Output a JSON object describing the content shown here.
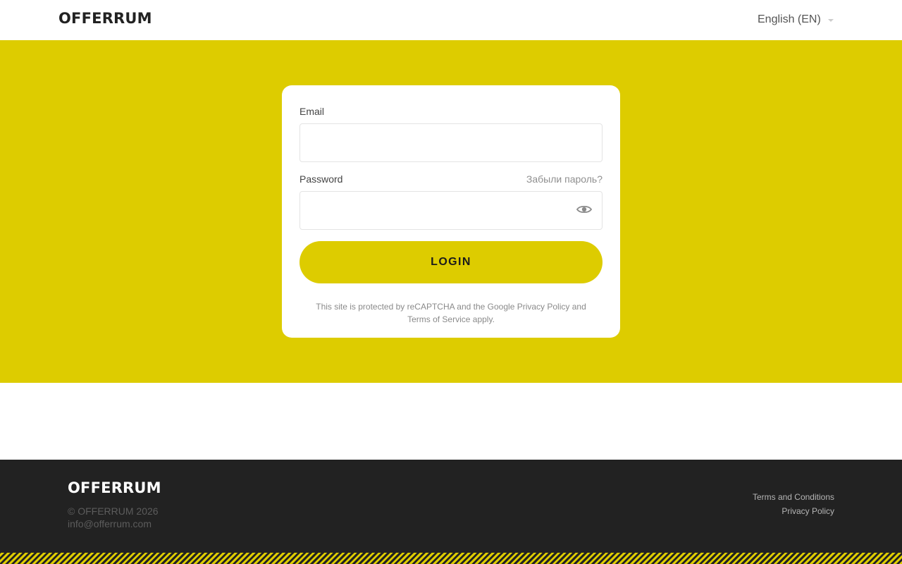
{
  "header": {
    "brand": "OFFERRUM",
    "language": "English (EN)"
  },
  "login": {
    "email_label": "Email",
    "email_value": "",
    "password_label": "Password",
    "password_value": "",
    "forgot_password": "Забыли пароль?",
    "submit_label": "LOGIN",
    "recaptcha_prefix": "This site is protected by reCAPTCHA and the Google ",
    "privacy_link": "Privacy Policy",
    "recaptcha_and": " and ",
    "terms_link": "Terms of Service",
    "recaptcha_suffix": " apply."
  },
  "footer": {
    "brand": "OFFERRUM",
    "copyright": "© OFFERRUM 2026",
    "email": "info@offerrum.com",
    "terms_link": "Terms and Conditions",
    "privacy_link": "Privacy Policy"
  },
  "icons": {
    "password_toggle": "eye-icon",
    "language_dropdown": "chevron-down-icon"
  },
  "colors": {
    "accent": "#ddcc00",
    "footer_bg": "#222222",
    "text_dark": "#222222"
  }
}
